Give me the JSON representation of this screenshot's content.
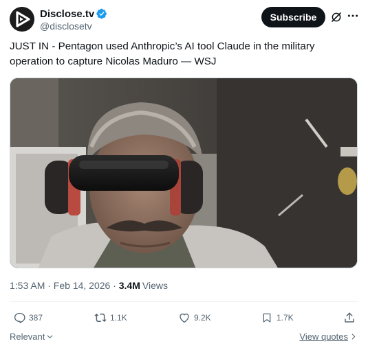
{
  "author": {
    "display_name": "Disclose.tv",
    "handle": "@disclosetv",
    "verified": true
  },
  "header": {
    "subscribe_label": "Subscribe",
    "grok_icon": "grok-icon",
    "more_icon": "more-icon"
  },
  "tweet": {
    "text": "JUST IN - Pentagon used Anthropic’s AI tool Claude in the military operation to capture Nicolas Maduro — WSJ"
  },
  "meta": {
    "timestamp": "1:53 AM · Feb 14, 2026 · ",
    "views_count": "3.4M",
    "views_label": "Views"
  },
  "actions": {
    "replies": "387",
    "reposts": "1.1K",
    "likes": "9.2K",
    "bookmarks": "1.7K"
  },
  "footer": {
    "sort_label": "Relevant",
    "view_quotes_label": "View quotes"
  },
  "colors": {
    "text": "#0f1419",
    "secondary": "#536471",
    "verified": "#1d9bf0",
    "button_bg": "#0f1419"
  }
}
